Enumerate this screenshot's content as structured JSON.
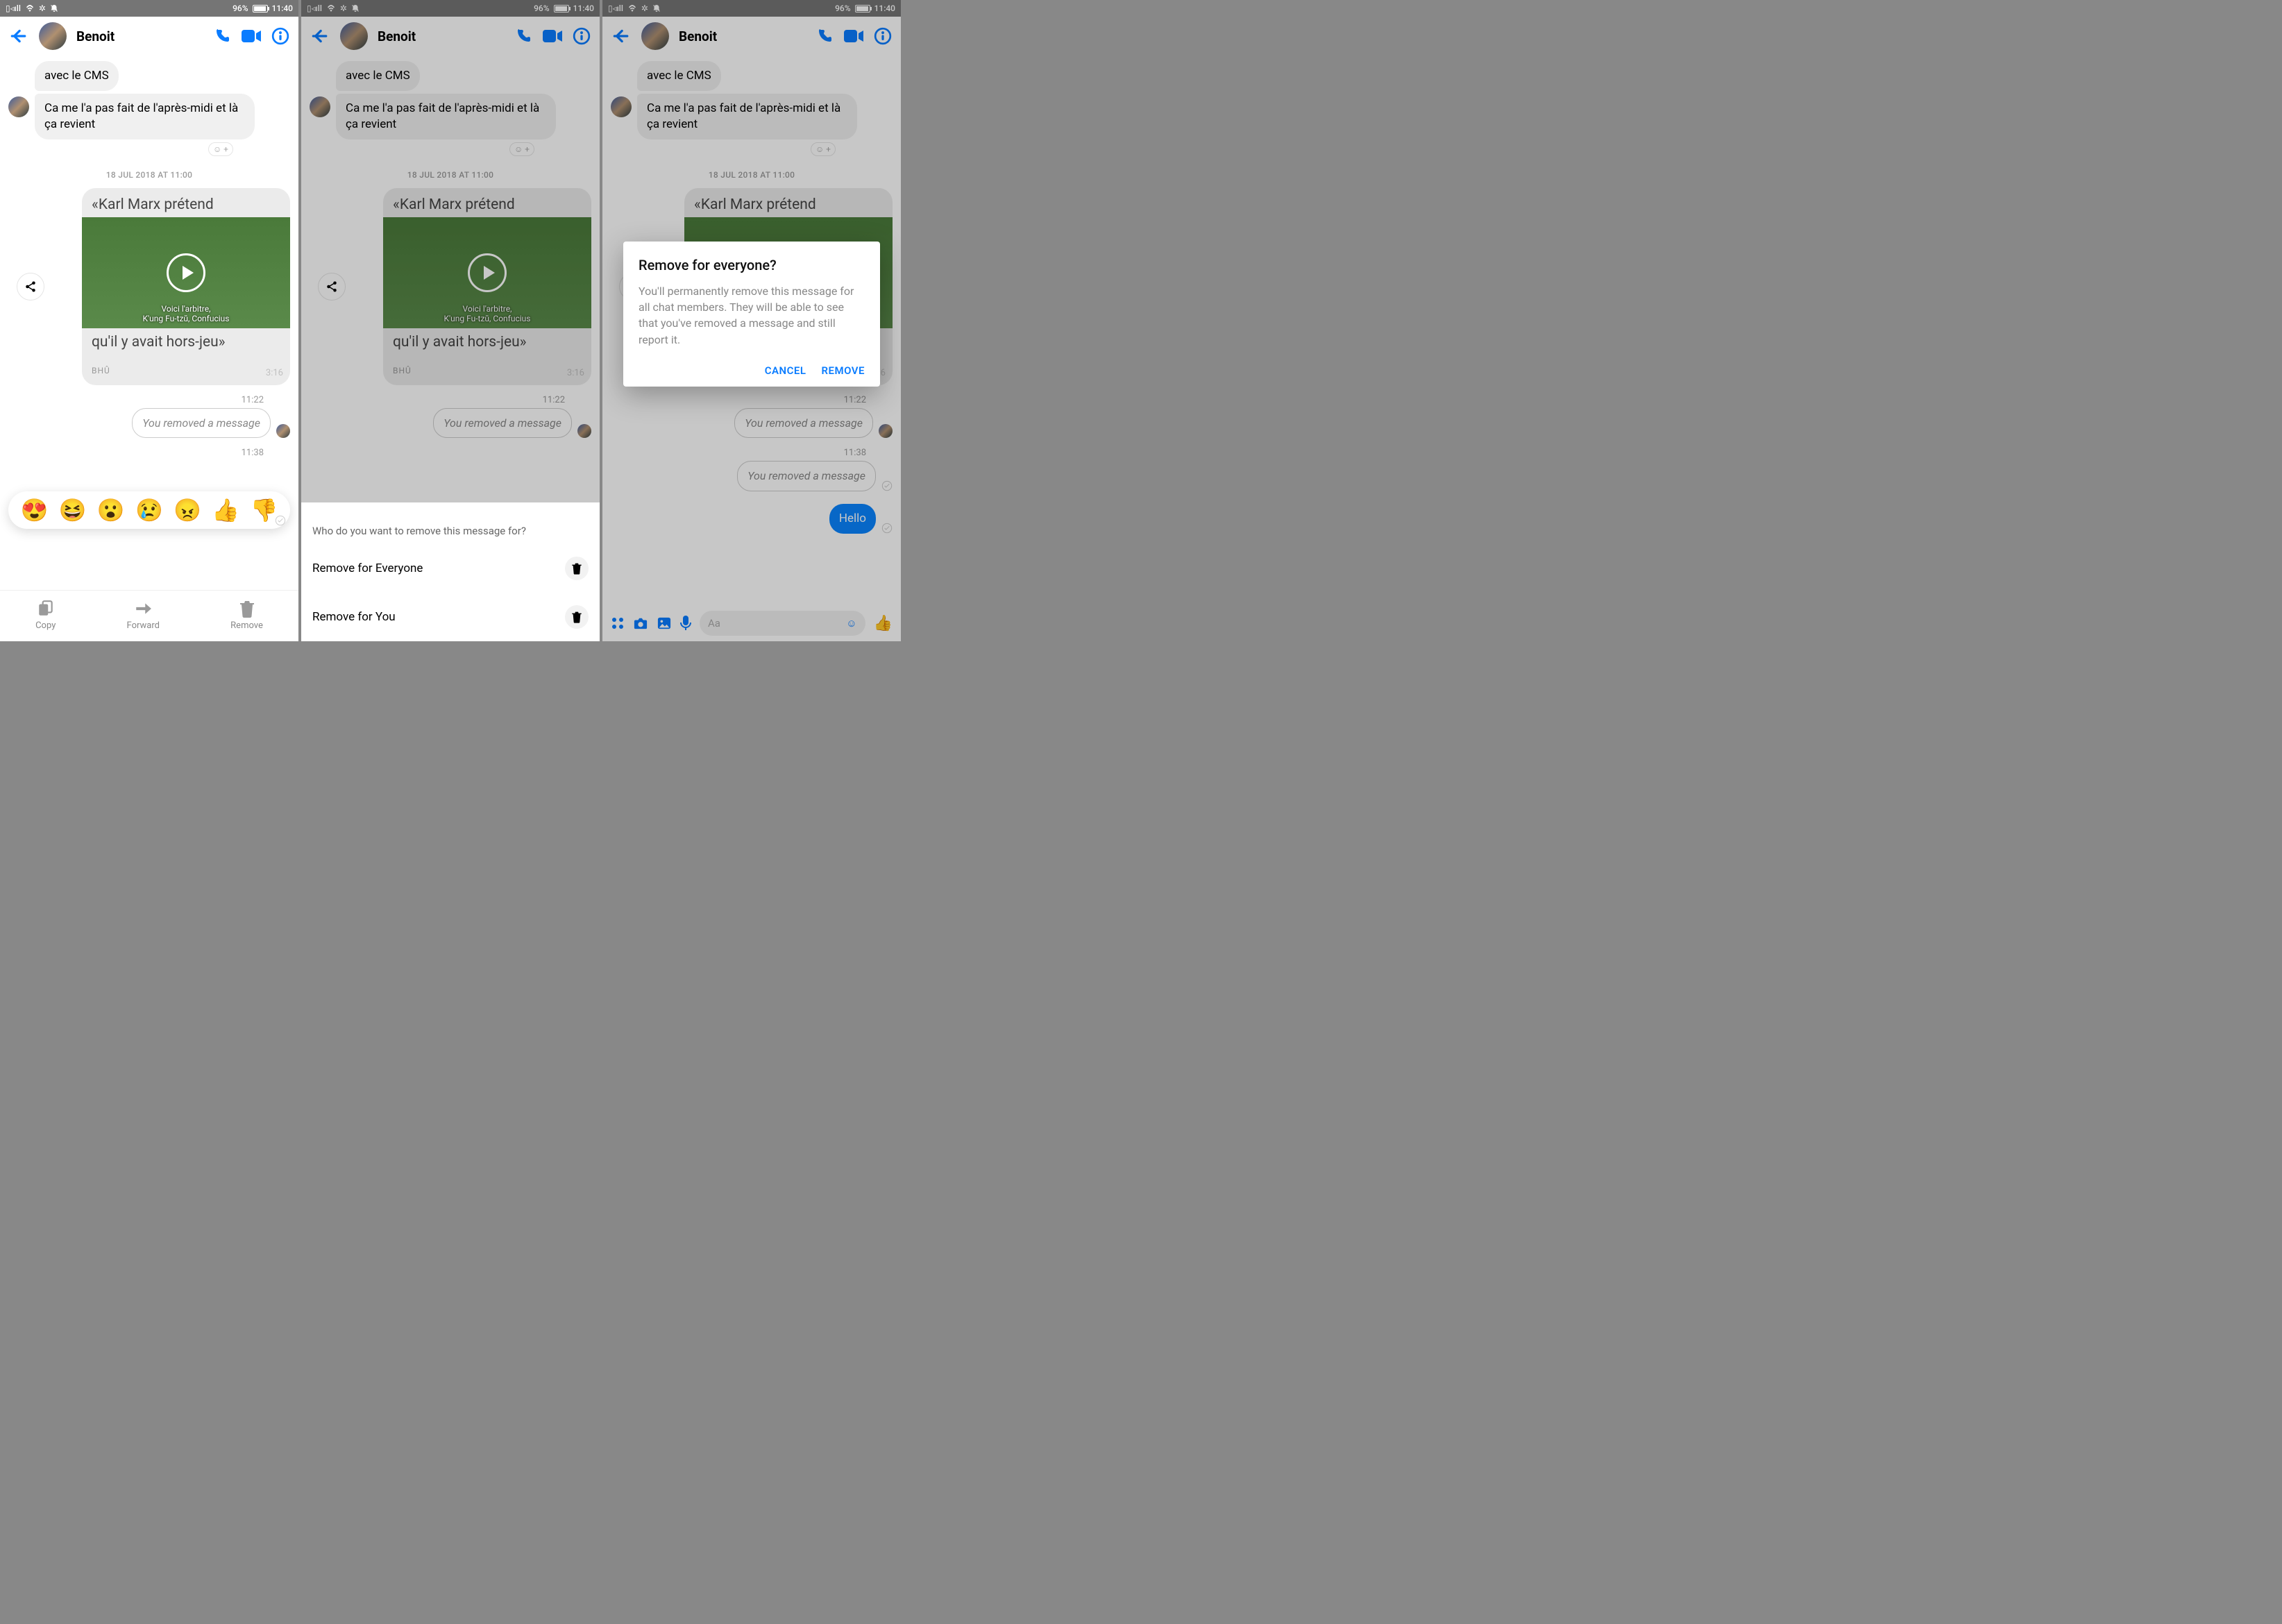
{
  "status": {
    "battery_pct": "96%",
    "time": "11:40"
  },
  "header": {
    "contact": "Benoit"
  },
  "chat": {
    "msg1": "avec le CMS",
    "msg2": "Ca me l'a pas fait de l'après-midi et là ça revient",
    "divider": "18 JUL 2018 AT 11:00",
    "card_title": "«Karl Marx prétend",
    "card_caption1": "Voici l'arbitre,",
    "card_caption2": "K'ung Fu-tzŭ, Confucius",
    "card_sub": "qu'il y avait hors-jeu»",
    "card_duration": "3:16",
    "card_source": "BHÛ",
    "t_1122": "11:22",
    "removed": "You removed a message",
    "t_1138": "11:38",
    "hello": "Hello"
  },
  "panel1": {
    "action_copy": "Copy",
    "action_forward": "Forward",
    "action_remove": "Remove"
  },
  "panel2": {
    "sheet_title": "Who do you want to remove this message for?",
    "opt_everyone": "Remove for Everyone",
    "opt_you": "Remove for You"
  },
  "panel3": {
    "dialog_title": "Remove for everyone?",
    "dialog_body": "You'll permanently remove this message for all chat members. They will be able to see that you've removed a message and still report it.",
    "cancel": "CANCEL",
    "remove": "REMOVE",
    "composer_placeholder": "Aa"
  }
}
